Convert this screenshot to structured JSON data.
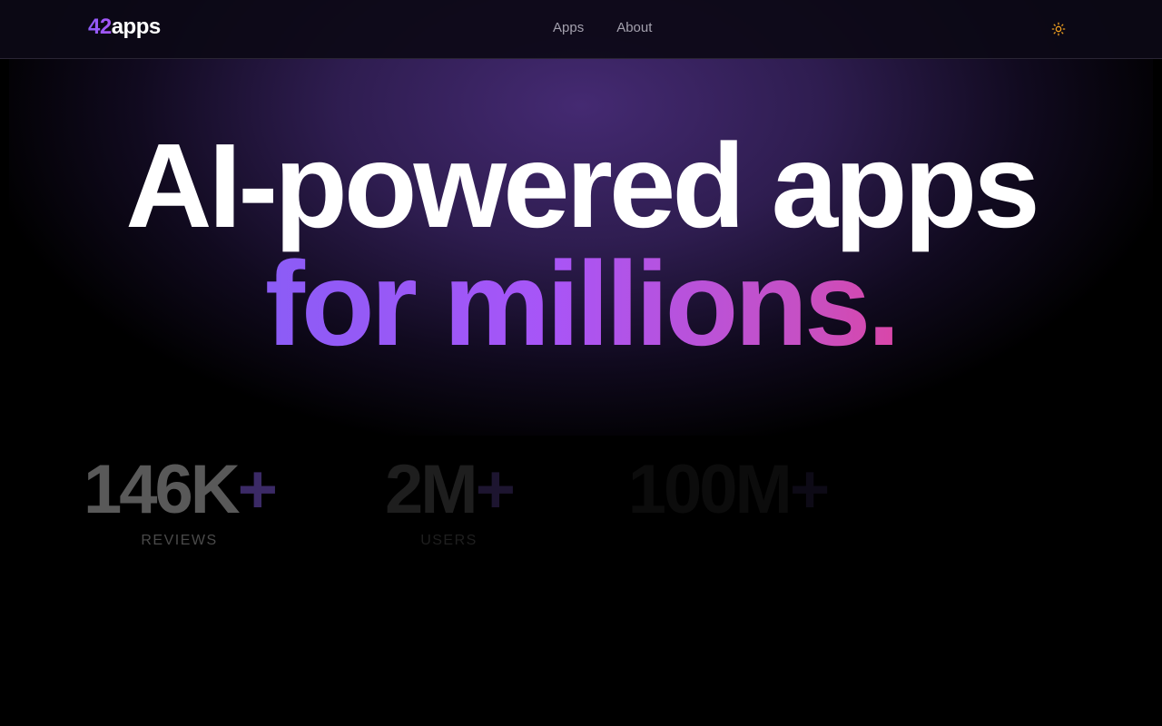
{
  "header": {
    "logo": {
      "number": "42",
      "word": "apps"
    },
    "nav": [
      {
        "label": "Apps"
      },
      {
        "label": "About"
      }
    ],
    "theme_toggle_icon": "sun-icon"
  },
  "hero": {
    "line1": "AI-powered apps",
    "line2": "for millions."
  },
  "stats": [
    {
      "value": "146K",
      "suffix": "+",
      "label": "REVIEWS"
    },
    {
      "value": "2M",
      "suffix": "+",
      "label": "USERS"
    },
    {
      "value": "100M",
      "suffix": "+",
      "label": ""
    }
  ],
  "colors": {
    "background": "#000000",
    "accent_purple": "#8b5cf6",
    "accent_pink": "#d946a8",
    "sun_icon": "#f0a020"
  }
}
